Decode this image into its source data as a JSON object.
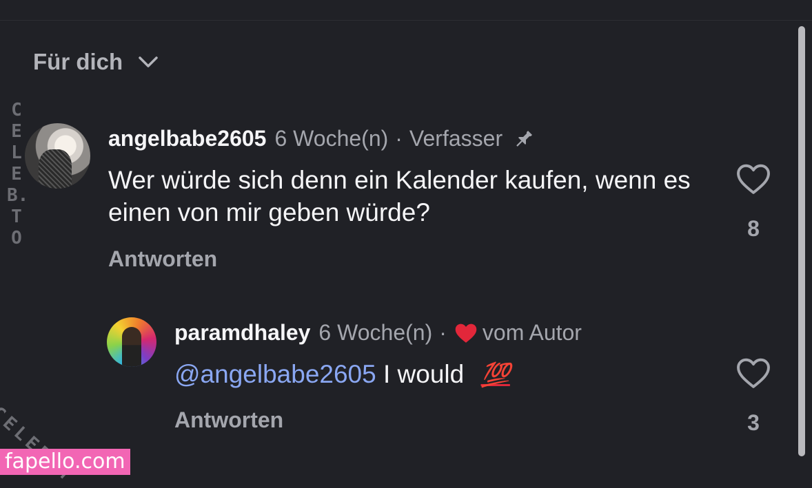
{
  "feed": {
    "filter_label": "Für dich"
  },
  "comments": [
    {
      "username": "angelbabe2605",
      "age": "6 Woche(n)",
      "separator": "·",
      "tag": "Verfasser",
      "text": "Wer würde sich denn ein Kalender kaufen, wenn es einen von mir geben würde?",
      "reply_label": "Antworten",
      "like_count": "8",
      "pinned": true
    },
    {
      "username": "paramdhaley",
      "age": "6 Woche(n)",
      "separator": "·",
      "tag": "vom Autor",
      "mention": "@angelbabe2605",
      "text": "I would",
      "emoji": "💯",
      "reply_label": "Antworten",
      "like_count": "3",
      "liked_by_author": true
    }
  ],
  "watermarks": {
    "vertical": "CELEB.TO",
    "diagonal": "CELEB.T"
  },
  "site_badge": "fapello.com",
  "colors": {
    "background": "#202126",
    "text_primary": "#f5f5f7",
    "text_secondary": "#a4a6ad",
    "mention": "#8aa7f2",
    "author_heart": "#e2273a",
    "badge": "#f266b4"
  }
}
